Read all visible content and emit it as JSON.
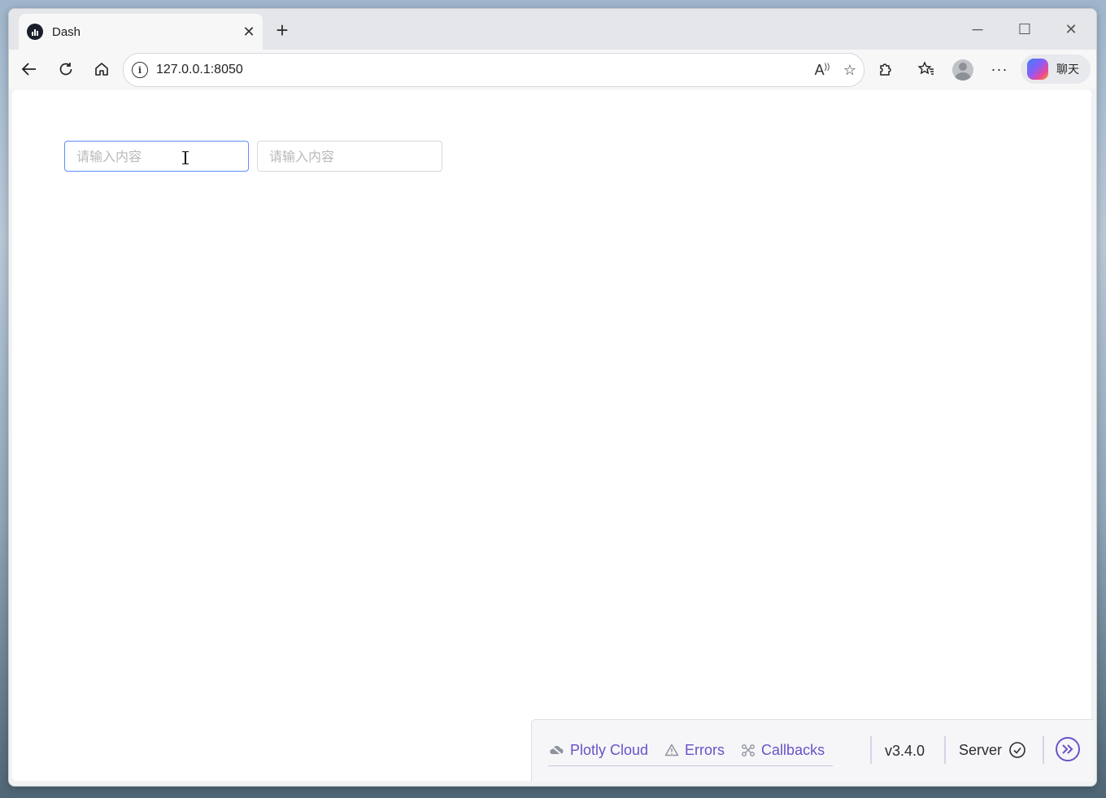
{
  "browser": {
    "tab_title": "Dash",
    "url": "127.0.0.1:8050",
    "copilot_label": "聊天"
  },
  "page": {
    "input_1_placeholder": "请输入内容",
    "input_2_placeholder": "请输入内容"
  },
  "devtools": {
    "plotly_cloud": "Plotly Cloud",
    "errors": "Errors",
    "callbacks": "Callbacks",
    "version": "v3.4.0",
    "server": "Server"
  },
  "colors": {
    "accent": "#6a52c9",
    "focus_border": "#5b8ff9"
  }
}
